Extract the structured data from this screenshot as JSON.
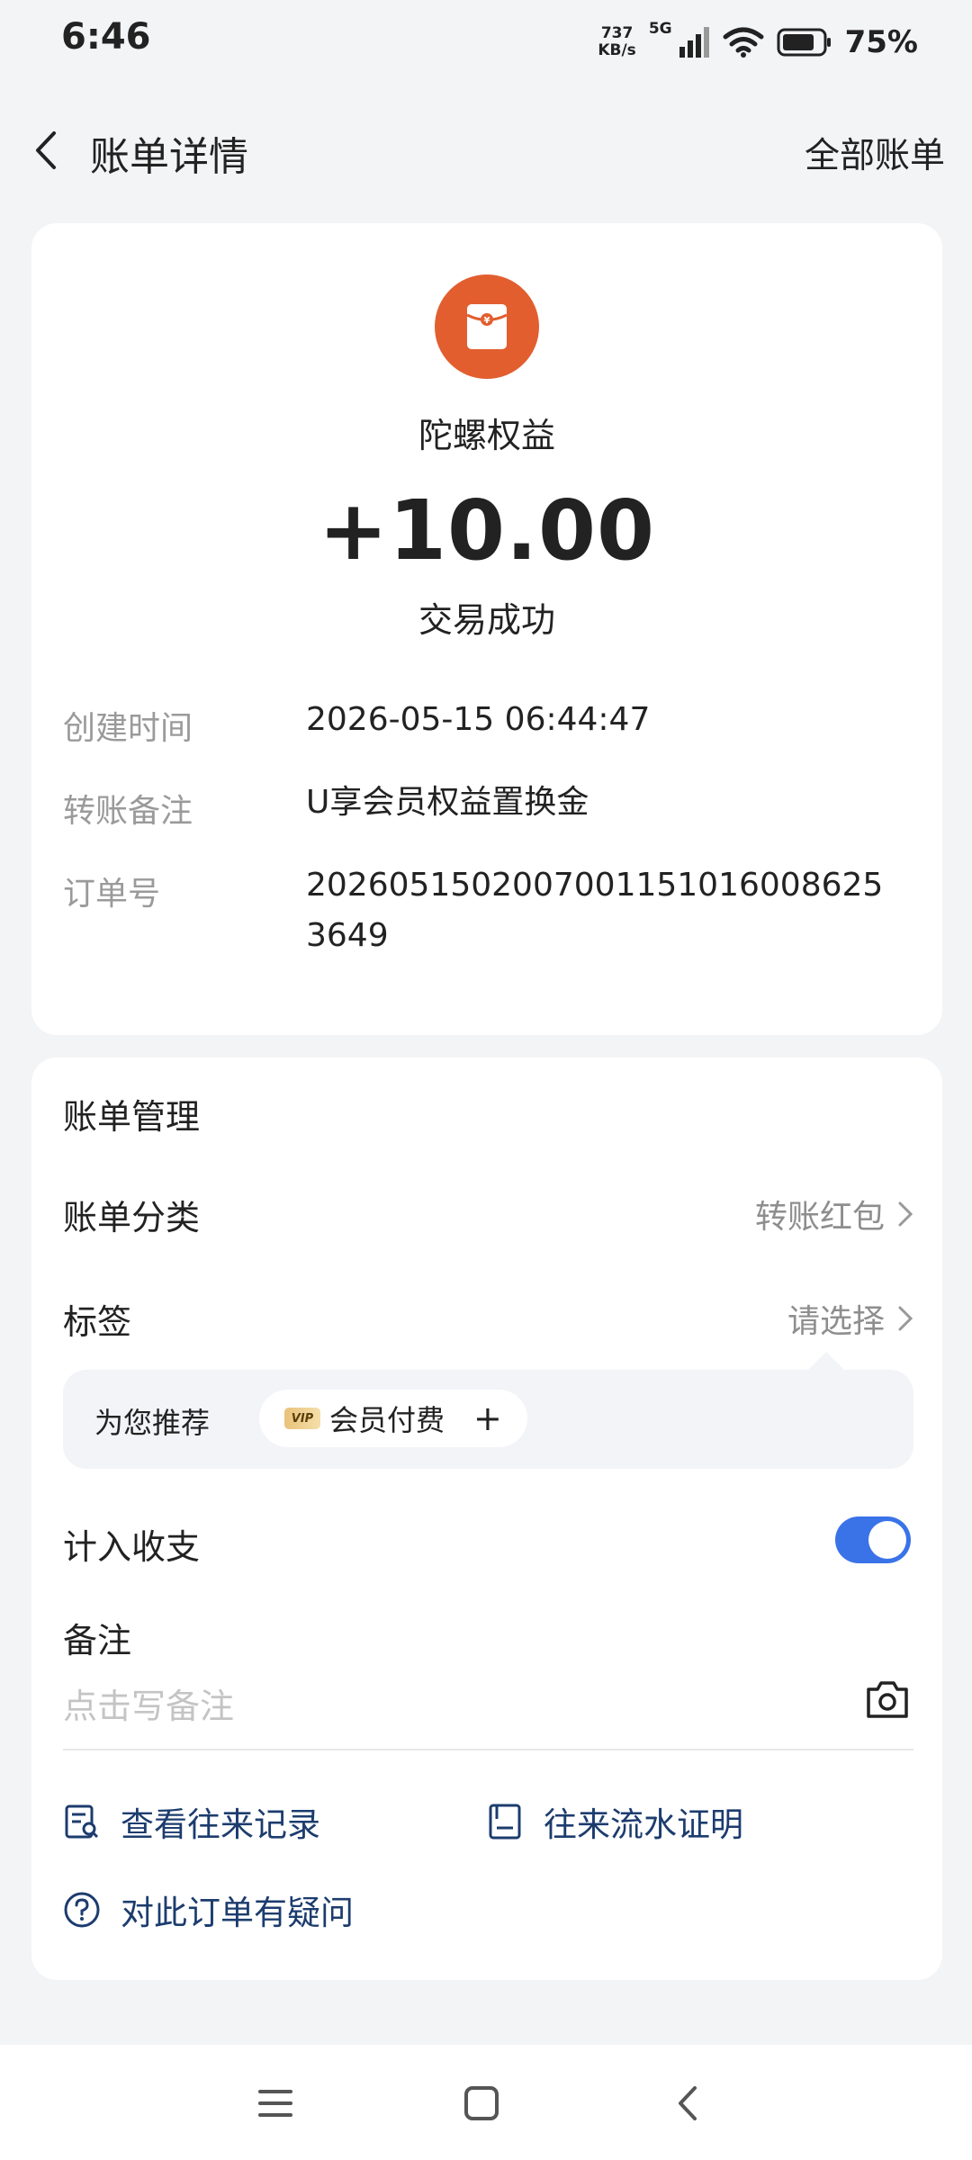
{
  "status_bar": {
    "time": "6:46",
    "net_speed_value": "737",
    "net_speed_unit": "KB/s",
    "network": "5G",
    "battery": "75%"
  },
  "header": {
    "title": "账单详情",
    "right_action": "全部账单"
  },
  "summary": {
    "merchant": "陀螺权益",
    "amount": "+10.00",
    "status": "交易成功",
    "logo_color": "#e25e2f"
  },
  "details": [
    {
      "label": "创建时间",
      "value": "2026-05-15 06:44:47"
    },
    {
      "label": "转账备注",
      "value": "U享会员权益置换金"
    },
    {
      "label": "订单号",
      "value": "20260515020070011510160086253649"
    }
  ],
  "management": {
    "title": "账单管理",
    "category_label": "账单分类",
    "category_value": "转账红包",
    "tag_label": "标签",
    "tag_value": "请选择",
    "recommend_label": "为您推荐",
    "recommend_tag_badge": "VIP",
    "recommend_tag": "会员付费",
    "recommend_add": "+",
    "count_in_label": "计入收支",
    "count_in_enabled": true,
    "note_label": "备注",
    "note_placeholder": "点击写备注"
  },
  "links": {
    "history": "查看往来记录",
    "proof": "往来流水证明",
    "question": "对此订单有疑问"
  },
  "colors": {
    "accent": "#3a73e8",
    "link": "#1c3c6e"
  }
}
